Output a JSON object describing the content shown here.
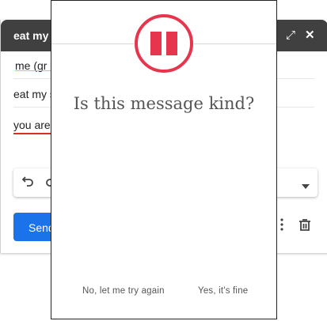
{
  "compose": {
    "title": "eat my",
    "to_value": "me (gr",
    "subject_value": "eat my s",
    "body_value": "you are",
    "send_label": "Send"
  },
  "modal": {
    "question": "Is this message kind?",
    "retry_label": "No, let me try again",
    "confirm_label": "Yes, it's fine",
    "accent_color": "#e8354e"
  },
  "icons": {
    "expand": "expand-icon",
    "close": "close-icon",
    "undo": "undo-icon",
    "redo": "redo-icon",
    "dropdown": "chevron-down-icon",
    "more": "more-vertical-icon",
    "trash": "trash-icon",
    "pause": "pause-icon"
  }
}
